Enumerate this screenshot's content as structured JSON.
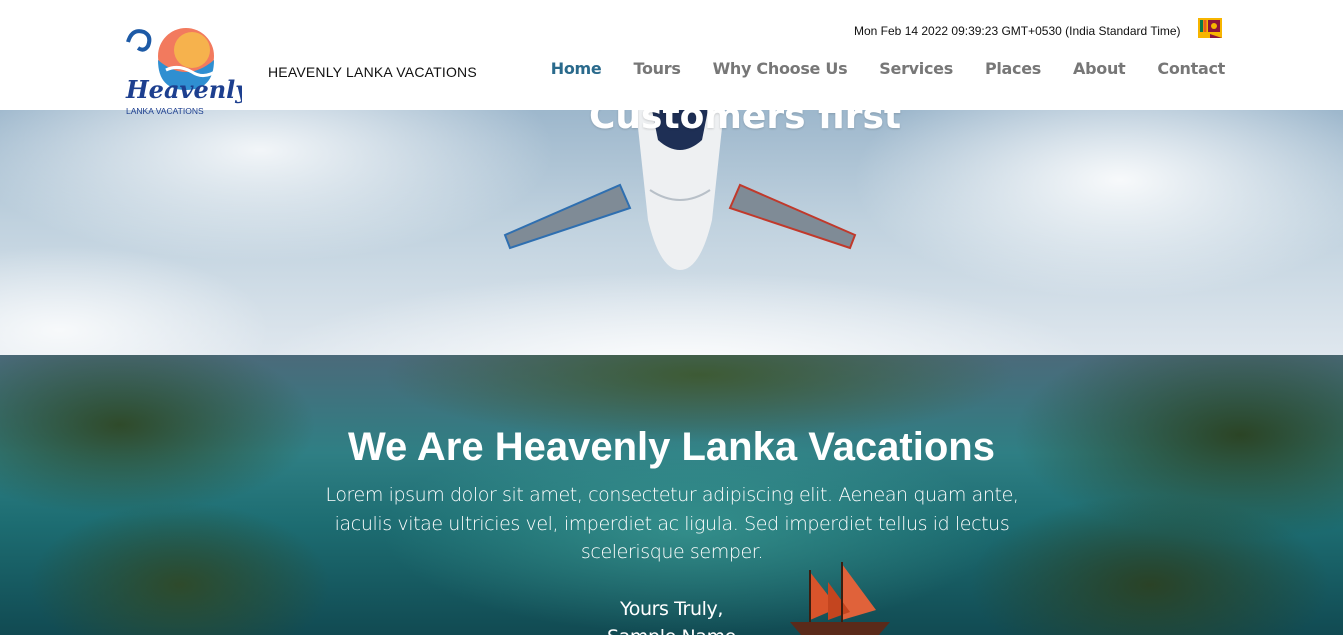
{
  "header": {
    "logo_text": "Heavenly",
    "logo_subtext": "LANKA VACATIONS",
    "brand_name": "HEAVENLY LANKA VACATIONS",
    "datetime": "Mon Feb 14 2022 09:39:23 GMT+0530 (India Standard Time)",
    "flag_icon": "sri-lanka-flag-icon",
    "nav": [
      {
        "label": "Home",
        "active": true
      },
      {
        "label": "Tours"
      },
      {
        "label": "Why Choose Us"
      },
      {
        "label": "Services"
      },
      {
        "label": "Places"
      },
      {
        "label": "About"
      },
      {
        "label": "Contact"
      }
    ],
    "colors": {
      "nav_active": "#2a6a8c",
      "nav": "#777777"
    }
  },
  "hero": {
    "title": "Customers first"
  },
  "about": {
    "title": "We Are Heavenly Lanka Vacations",
    "body": "Lorem ipsum dolor sit amet, consectetur adipiscing elit. Aenean quam ante, iaculis vitae ultricies vel, imperdiet ac ligula. Sed imperdiet tellus id lectus scelerisque semper.",
    "closing": "Yours Truly,",
    "signature": "Sample Name"
  }
}
